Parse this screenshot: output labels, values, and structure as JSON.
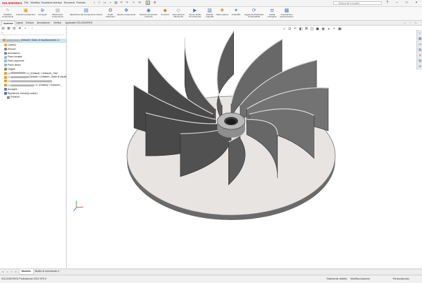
{
  "app": {
    "logo": "SOLIDWORKS",
    "menu": [
      "File",
      "Modifica",
      "Visualizza",
      "Inserisci",
      "Strumenti",
      "Finestra"
    ],
    "search_placeholder": "Ricerca file e modelli"
  },
  "ribbon": {
    "items": [
      {
        "label": "Modifica\ncomponente",
        "icon": "edit-component-icon",
        "glyph": "✎",
        "color": "#b7b7b7"
      },
      {
        "label": "Inserisci componenti",
        "icon": "insert-components-icon",
        "glyph": "▣",
        "color": "#e0a020"
      },
      {
        "label": "Accoppia",
        "icon": "mate-icon",
        "glyph": "⊕",
        "color": "#5a7fb0"
      },
      {
        "label": "Riferimento\ncomponente",
        "icon": "component-reference-icon",
        "glyph": "▦",
        "color": "#b7b7b7"
      },
      {
        "label": "Ripetizione del componente lineare",
        "icon": "linear-pattern-icon",
        "glyph": "▤",
        "color": "#4a78b5"
      },
      {
        "label": "Smart\nFasteners",
        "icon": "smart-fasteners-icon",
        "glyph": "⚙",
        "color": "#707070"
      },
      {
        "label": "Sposta componente",
        "icon": "move-component-icon",
        "glyph": "✥",
        "color": "#4a78b5"
      },
      {
        "label": "Mostra componenti\nnascosti",
        "icon": "show-hidden-icon",
        "glyph": "◉",
        "color": "#4a78b5"
      },
      {
        "label": "Funzioni\n...",
        "icon": "features-icon",
        "glyph": "◆",
        "color": "#c98b2c"
      },
      {
        "label": "Geometria di\nriferimento",
        "icon": "reference-geometry-icon",
        "glyph": "◇",
        "color": "#7a7a7a"
      },
      {
        "label": "Nuovo studio\ndi movimento",
        "icon": "motion-study-icon",
        "glyph": "▶",
        "color": "#4a78b5"
      },
      {
        "label": "Distinta\nmateriali",
        "icon": "bill-of-materials-icon",
        "glyph": "▥",
        "color": "#4a78b5"
      },
      {
        "label": "Vista esplosa",
        "icon": "exploded-view-icon",
        "glyph": "❖",
        "color": "#c98b2c"
      },
      {
        "label": "Instant3D",
        "icon": "instant3d-icon",
        "glyph": "✦",
        "color": "#4a78b5"
      },
      {
        "label": "Aggiorna scheletrato\ndi SpeedPak",
        "icon": "speedpak-icon",
        "glyph": "⟳",
        "color": "#4a78b5"
      },
      {
        "label": "Scatta\nimmagine",
        "icon": "snapshot-icon",
        "glyph": "◘",
        "color": "#4a78b5"
      },
      {
        "label": "Impostazioni\ngrandi assiemi",
        "icon": "large-assembly-icon",
        "glyph": "▩",
        "color": "#4a78b5"
      }
    ]
  },
  "tabs": [
    "Assieme",
    "Layout",
    "Schizzo",
    "Annotazione",
    "Verifica",
    "Applicativi SOLIDWORKS"
  ],
  "tree": {
    "root": "(Default) <Stato di visualizzazione-1>",
    "items": [
      {
        "label": "Cartella",
        "color": "#e0b040",
        "indent": 1
      },
      {
        "label": "Sensori",
        "color": "#8a8a8a",
        "indent": 1
      },
      {
        "label": "Annotazioni",
        "color": "#8a8a8a",
        "indent": 1
      },
      {
        "label": "Piano frontale",
        "color": "#9fb6cf",
        "indent": 1
      },
      {
        "label": "Piano superiore",
        "color": "#9fb6cf",
        "indent": 1
      },
      {
        "label": "Piano destro",
        "color": "#9fb6cf",
        "indent": 1
      },
      {
        "label": "Origine",
        "color": "#8a8a8a",
        "indent": 1
      }
    ],
    "components": [
      {
        "prefix": "(-)",
        "suffix": "<1> (Default) <<Default>_Stat"
      },
      {
        "prefix": "(-)",
        "suffix": "(Default) <<Default>_Stato di visualizz"
      },
      {
        "prefix": "(-)",
        "suffix": ""
      },
      {
        "prefix": "(-)",
        "suffix": "<1> (Default) <<Default>_"
      }
    ],
    "tail": [
      {
        "label": "Accoppie",
        "color": "#5a7fb0"
      },
      {
        "label": "Ripetizione Lineare(Locale)1",
        "color": "#4a78b5"
      },
      {
        "label": "Schizzo1",
        "color": "#8a8a8a"
      }
    ]
  },
  "bottom_tabs": [
    "Modello",
    "Studio di movimento 1"
  ],
  "status": {
    "app": "SOLIDWORKS Professional 2024 SP5.0",
    "state1": "Totalmente definito",
    "state2": "Modifica Assieme",
    "units": "Personalizzato"
  },
  "colors": {
    "accent": "#d2232a",
    "selection": "#cfe4f7",
    "blade_dark": "#5a5a5a",
    "disc": "#e8e4e2"
  }
}
